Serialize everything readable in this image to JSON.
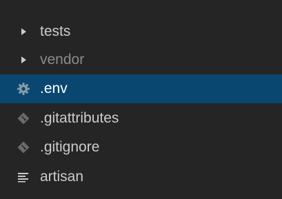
{
  "explorer": {
    "clipped_label": "",
    "items": [
      {
        "label": "tests",
        "icon": "chevron-right-icon",
        "kind": "folder"
      },
      {
        "label": "vendor",
        "icon": "chevron-right-icon",
        "kind": "folder"
      },
      {
        "label": ".env",
        "icon": "gear-icon",
        "kind": "file",
        "selected": true
      },
      {
        "label": ".gitattributes",
        "icon": "git-icon",
        "kind": "file"
      },
      {
        "label": ".gitignore",
        "icon": "git-icon",
        "kind": "file"
      },
      {
        "label": "artisan",
        "icon": "lines-icon",
        "kind": "file"
      }
    ]
  },
  "colors": {
    "background": "#252526",
    "selection": "#094771",
    "text": "#cccccc",
    "git_icon": "#6a6a6a"
  }
}
